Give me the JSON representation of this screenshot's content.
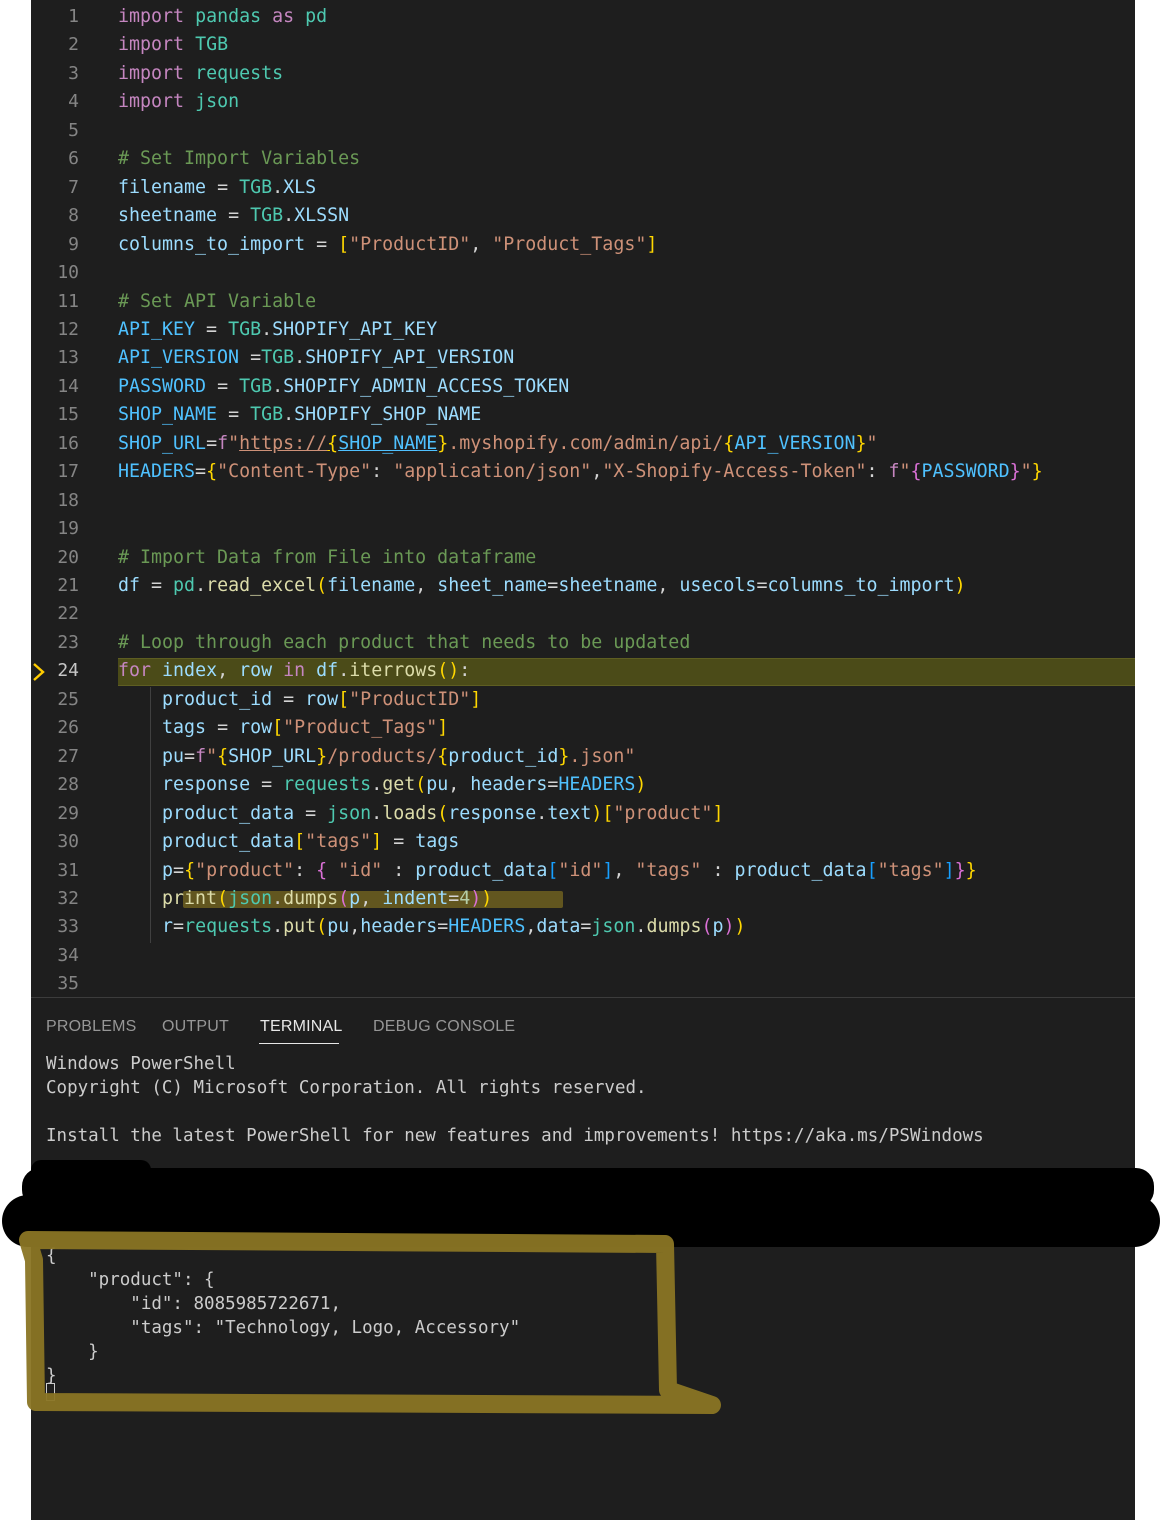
{
  "editor": {
    "current_line": "24",
    "lines": [
      {
        "num": "1",
        "segs": [
          [
            "k",
            "import"
          ],
          [
            "t",
            " "
          ],
          [
            "m",
            "pandas"
          ],
          [
            "t",
            " "
          ],
          [
            "k",
            "as"
          ],
          [
            "t",
            " "
          ],
          [
            "m",
            "pd"
          ]
        ]
      },
      {
        "num": "2",
        "segs": [
          [
            "k",
            "import"
          ],
          [
            "t",
            " "
          ],
          [
            "m",
            "TGB"
          ]
        ]
      },
      {
        "num": "3",
        "segs": [
          [
            "k",
            "import"
          ],
          [
            "t",
            " "
          ],
          [
            "m",
            "requests"
          ]
        ]
      },
      {
        "num": "4",
        "segs": [
          [
            "k",
            "import"
          ],
          [
            "t",
            " "
          ],
          [
            "m",
            "json"
          ]
        ]
      },
      {
        "num": "5",
        "segs": []
      },
      {
        "num": "6",
        "segs": [
          [
            "c",
            "# Set Import Variables"
          ]
        ]
      },
      {
        "num": "7",
        "segs": [
          [
            "v",
            "filename"
          ],
          [
            "t",
            " = "
          ],
          [
            "m",
            "TGB"
          ],
          [
            "t",
            "."
          ],
          [
            "v",
            "XLS"
          ]
        ]
      },
      {
        "num": "8",
        "segs": [
          [
            "v",
            "sheetname"
          ],
          [
            "t",
            " = "
          ],
          [
            "m",
            "TGB"
          ],
          [
            "t",
            "."
          ],
          [
            "v",
            "XLSSN"
          ]
        ]
      },
      {
        "num": "9",
        "segs": [
          [
            "v",
            "columns_to_import"
          ],
          [
            "t",
            " = "
          ],
          [
            "b1",
            "["
          ],
          [
            "s",
            "\"ProductID\""
          ],
          [
            "t",
            ", "
          ],
          [
            "s",
            "\"Product_Tags\""
          ],
          [
            "b1",
            "]"
          ]
        ]
      },
      {
        "num": "10",
        "segs": []
      },
      {
        "num": "11",
        "segs": [
          [
            "c",
            "# Set API Variable"
          ]
        ]
      },
      {
        "num": "12",
        "segs": [
          [
            "cn",
            "API_KEY"
          ],
          [
            "t",
            " = "
          ],
          [
            "m",
            "TGB"
          ],
          [
            "t",
            "."
          ],
          [
            "v",
            "SHOPIFY_API_KEY"
          ]
        ]
      },
      {
        "num": "13",
        "segs": [
          [
            "cn",
            "API_VERSION"
          ],
          [
            "t",
            " ="
          ],
          [
            "m",
            "TGB"
          ],
          [
            "t",
            "."
          ],
          [
            "v",
            "SHOPIFY_API_VERSION"
          ]
        ]
      },
      {
        "num": "14",
        "segs": [
          [
            "cn",
            "PASSWORD"
          ],
          [
            "t",
            " = "
          ],
          [
            "m",
            "TGB"
          ],
          [
            "t",
            "."
          ],
          [
            "v",
            "SHOPIFY_ADMIN_ACCESS_TOKEN"
          ]
        ]
      },
      {
        "num": "15",
        "segs": [
          [
            "cn",
            "SHOP_NAME"
          ],
          [
            "t",
            " = "
          ],
          [
            "m",
            "TGB"
          ],
          [
            "t",
            "."
          ],
          [
            "v",
            "SHOPIFY_SHOP_NAME"
          ]
        ]
      },
      {
        "num": "16",
        "segs": [
          [
            "cn",
            "SHOP_URL"
          ],
          [
            "t",
            "="
          ],
          [
            "k",
            "f"
          ],
          [
            "s",
            "\""
          ],
          [
            "s u",
            "https://"
          ],
          [
            "b1 u",
            "{"
          ],
          [
            "cn u",
            "SHOP_NAME"
          ],
          [
            "b1",
            "}"
          ],
          [
            "s",
            ".myshopify.com/admin/api/"
          ],
          [
            "b1",
            "{"
          ],
          [
            "cn",
            "API_VERSION"
          ],
          [
            "b1",
            "}"
          ],
          [
            "s",
            "\""
          ]
        ]
      },
      {
        "num": "17",
        "segs": [
          [
            "cn",
            "HEADERS"
          ],
          [
            "t",
            "="
          ],
          [
            "b1",
            "{"
          ],
          [
            "s",
            "\"Content-Type\""
          ],
          [
            "t",
            ": "
          ],
          [
            "s",
            "\"application/json\""
          ],
          [
            "t",
            ","
          ],
          [
            "s",
            "\"X-Shopify-Access-Token\""
          ],
          [
            "t",
            ": "
          ],
          [
            "k",
            "f"
          ],
          [
            "s",
            "\""
          ],
          [
            "b2",
            "{"
          ],
          [
            "cn",
            "PASSWORD"
          ],
          [
            "b2",
            "}"
          ],
          [
            "s",
            "\""
          ],
          [
            "b1",
            "}"
          ]
        ]
      },
      {
        "num": "18",
        "segs": []
      },
      {
        "num": "19",
        "segs": []
      },
      {
        "num": "20",
        "segs": [
          [
            "c",
            "# Import Data from File into dataframe"
          ]
        ]
      },
      {
        "num": "21",
        "segs": [
          [
            "v",
            "df"
          ],
          [
            "t",
            " = "
          ],
          [
            "m",
            "pd"
          ],
          [
            "t",
            "."
          ],
          [
            "f",
            "read_excel"
          ],
          [
            "b1",
            "("
          ],
          [
            "v",
            "filename"
          ],
          [
            "t",
            ", "
          ],
          [
            "v",
            "sheet_name"
          ],
          [
            "t",
            "="
          ],
          [
            "v",
            "sheetname"
          ],
          [
            "t",
            ", "
          ],
          [
            "v",
            "usecols"
          ],
          [
            "t",
            "="
          ],
          [
            "v",
            "columns_to_import"
          ],
          [
            "b1",
            ")"
          ]
        ]
      },
      {
        "num": "22",
        "segs": []
      },
      {
        "num": "23",
        "segs": [
          [
            "c",
            "# Loop through each product that needs to be updated"
          ]
        ]
      },
      {
        "num": "24",
        "segs": [
          [
            "k",
            "for"
          ],
          [
            "t",
            " "
          ],
          [
            "v",
            "index"
          ],
          [
            "t",
            ", "
          ],
          [
            "v",
            "row"
          ],
          [
            "t",
            " "
          ],
          [
            "k",
            "in"
          ],
          [
            "t",
            " "
          ],
          [
            "v",
            "df"
          ],
          [
            "t",
            "."
          ],
          [
            "f",
            "iterrows"
          ],
          [
            "b1",
            "()"
          ],
          [
            "t",
            ":"
          ]
        ]
      },
      {
        "num": "25",
        "segs": [
          [
            "t",
            "    "
          ],
          [
            "v",
            "product_id"
          ],
          [
            "t",
            " = "
          ],
          [
            "v",
            "row"
          ],
          [
            "b1",
            "["
          ],
          [
            "s",
            "\"ProductID\""
          ],
          [
            "b1",
            "]"
          ]
        ]
      },
      {
        "num": "26",
        "segs": [
          [
            "t",
            "    "
          ],
          [
            "v",
            "tags"
          ],
          [
            "t",
            " = "
          ],
          [
            "v",
            "row"
          ],
          [
            "b1",
            "["
          ],
          [
            "s",
            "\"Product_Tags\""
          ],
          [
            "b1",
            "]"
          ]
        ]
      },
      {
        "num": "27",
        "segs": [
          [
            "t",
            "    "
          ],
          [
            "v",
            "pu"
          ],
          [
            "t",
            "="
          ],
          [
            "k",
            "f"
          ],
          [
            "s",
            "\""
          ],
          [
            "b1",
            "{"
          ],
          [
            "v",
            "SHOP_URL"
          ],
          [
            "b1",
            "}"
          ],
          [
            "s",
            "/products/"
          ],
          [
            "b1",
            "{"
          ],
          [
            "v",
            "product_id"
          ],
          [
            "b1",
            "}"
          ],
          [
            "s",
            ".json\""
          ]
        ]
      },
      {
        "num": "28",
        "segs": [
          [
            "t",
            "    "
          ],
          [
            "v",
            "response"
          ],
          [
            "t",
            " = "
          ],
          [
            "m",
            "requests"
          ],
          [
            "t",
            "."
          ],
          [
            "f",
            "get"
          ],
          [
            "b1",
            "("
          ],
          [
            "v",
            "pu"
          ],
          [
            "t",
            ", "
          ],
          [
            "v",
            "headers"
          ],
          [
            "t",
            "="
          ],
          [
            "cn",
            "HEADERS"
          ],
          [
            "b1",
            ")"
          ]
        ]
      },
      {
        "num": "29",
        "segs": [
          [
            "t",
            "    "
          ],
          [
            "v",
            "product_data"
          ],
          [
            "t",
            " = "
          ],
          [
            "m",
            "json"
          ],
          [
            "t",
            "."
          ],
          [
            "f",
            "loads"
          ],
          [
            "b1",
            "("
          ],
          [
            "v",
            "response"
          ],
          [
            "t",
            "."
          ],
          [
            "v",
            "text"
          ],
          [
            "b1",
            ")"
          ],
          [
            "b1",
            "["
          ],
          [
            "s",
            "\"product\""
          ],
          [
            "b1",
            "]"
          ]
        ]
      },
      {
        "num": "30",
        "segs": [
          [
            "t",
            "    "
          ],
          [
            "v",
            "product_data"
          ],
          [
            "b1",
            "["
          ],
          [
            "s",
            "\"tags\""
          ],
          [
            "b1",
            "]"
          ],
          [
            "t",
            " = "
          ],
          [
            "v",
            "tags"
          ]
        ]
      },
      {
        "num": "31",
        "segs": [
          [
            "t",
            "    "
          ],
          [
            "v",
            "p"
          ],
          [
            "t",
            "="
          ],
          [
            "b1",
            "{"
          ],
          [
            "s",
            "\"product\""
          ],
          [
            "t",
            ": "
          ],
          [
            "b2",
            "{"
          ],
          [
            "t",
            " "
          ],
          [
            "s",
            "\"id\""
          ],
          [
            "t",
            " : "
          ],
          [
            "v",
            "product_data"
          ],
          [
            "b3",
            "["
          ],
          [
            "s",
            "\"id\""
          ],
          [
            "b3",
            "]"
          ],
          [
            "t",
            ", "
          ],
          [
            "s",
            "\"tags\""
          ],
          [
            "t",
            " : "
          ],
          [
            "v",
            "product_data"
          ],
          [
            "b3",
            "["
          ],
          [
            "s",
            "\"tags\""
          ],
          [
            "b3",
            "]"
          ],
          [
            "b2",
            "}"
          ],
          [
            "b1",
            "}"
          ]
        ]
      },
      {
        "num": "32",
        "segs": [
          [
            "t",
            "    "
          ],
          [
            "f",
            "print"
          ],
          [
            "b1",
            "("
          ],
          [
            "m",
            "json"
          ],
          [
            "t",
            "."
          ],
          [
            "f",
            "dumps"
          ],
          [
            "b2",
            "("
          ],
          [
            "v",
            "p"
          ],
          [
            "t",
            ", "
          ],
          [
            "v",
            "indent"
          ],
          [
            "t",
            "="
          ],
          [
            "n",
            "4"
          ],
          [
            "b2",
            ")"
          ],
          [
            "b1",
            ")"
          ]
        ]
      },
      {
        "num": "33",
        "segs": [
          [
            "t",
            "    "
          ],
          [
            "v",
            "r"
          ],
          [
            "t",
            "="
          ],
          [
            "m",
            "requests"
          ],
          [
            "t",
            "."
          ],
          [
            "f",
            "put"
          ],
          [
            "b1",
            "("
          ],
          [
            "v",
            "pu"
          ],
          [
            "t",
            ","
          ],
          [
            "v",
            "headers"
          ],
          [
            "t",
            "="
          ],
          [
            "cn",
            "HEADERS"
          ],
          [
            "t",
            ","
          ],
          [
            "v",
            "data"
          ],
          [
            "t",
            "="
          ],
          [
            "m",
            "json"
          ],
          [
            "t",
            "."
          ],
          [
            "f",
            "dumps"
          ],
          [
            "b2",
            "("
          ],
          [
            "v",
            "p"
          ],
          [
            "b2",
            ")"
          ],
          [
            "b1",
            ")"
          ]
        ]
      },
      {
        "num": "34",
        "segs": []
      },
      {
        "num": "35",
        "segs": []
      }
    ]
  },
  "panel": {
    "tabs": [
      "PROBLEMS",
      "OUTPUT",
      "TERMINAL",
      "DEBUG CONSOLE"
    ],
    "active_tab": "TERMINAL"
  },
  "terminal": {
    "header_lines": [
      "Windows PowerShell",
      "Copyright (C) Microsoft Corporation. All rights reserved.",
      "",
      "Install the latest PowerShell for new features and improvements! https://aka.ms/PSWindows"
    ],
    "output_lines": [
      "{",
      "    \"product\": {",
      "        \"id\": 8085985722671,",
      "        \"tags\": \"Technology, Logo, Accessory\"",
      "    }",
      "}"
    ]
  },
  "colors": {
    "background": "#1e1e1e",
    "highlight_line": "#4b4b18",
    "annotation": "#8a7524"
  }
}
